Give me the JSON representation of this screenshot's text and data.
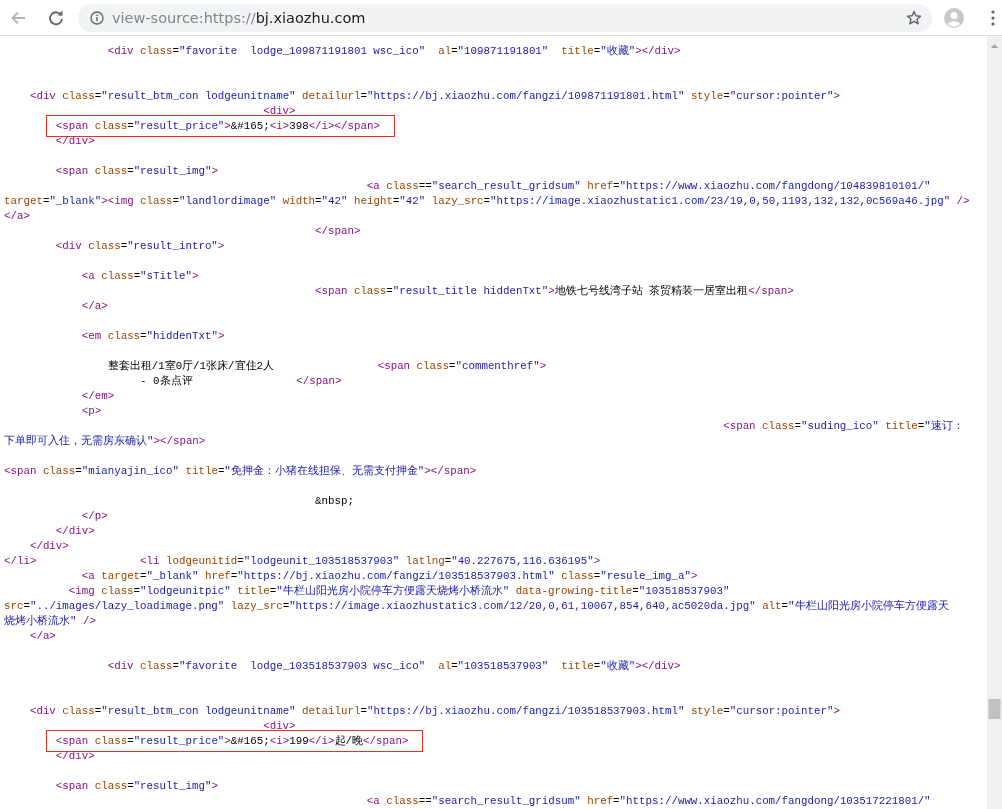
{
  "address_bar": {
    "scheme": "view-source:https://",
    "host": "bj.xiaozhu.com"
  },
  "source_lines": [
    {
      "kind": "code",
      "highlighted": false,
      "text": "                <div class=\"favorite  lodge_109871191801 wsc_ico\"  al=\"109871191801\"  title=\"收藏\"></div>"
    },
    {
      "kind": "blank"
    },
    {
      "kind": "blank"
    },
    {
      "kind": "code",
      "highlighted": false,
      "text": "    <div class=\"result_btm_con lodgeunitname\" detailurl=\"https://bj.xiaozhu.com/fangzi/109871191801.html\" style=\"cursor:pointer\">"
    },
    {
      "kind": "code",
      "highlighted": false,
      "text": "                                        <div>"
    },
    {
      "kind": "code",
      "highlighted": true,
      "text": "        <span class=\"result_price\">&#165;<i>398</i></span>"
    },
    {
      "kind": "code",
      "highlighted": false,
      "text": "        </div>"
    },
    {
      "kind": "blank"
    },
    {
      "kind": "code",
      "highlighted": false,
      "text": "        <span class=\"result_img\">"
    },
    {
      "kind": "code",
      "highlighted": false,
      "text": "                                                        <a class==\"search_result_gridsum\" href=\"https://www.xiaozhu.com/fangdong/104839810101/\""
    },
    {
      "kind": "code",
      "highlighted": false,
      "text": "target=\"_blank\"><img class=\"landlordimage\" width=\"42\" height=\"42\" lazy_src=\"https://image.xiaozhustatic1.com/23/19,0,50,1193,132,132,0c569a46.jpg\" />"
    },
    {
      "kind": "code",
      "highlighted": false,
      "text": "</a>"
    },
    {
      "kind": "code",
      "highlighted": false,
      "text": "                                                </span>"
    },
    {
      "kind": "code",
      "highlighted": false,
      "text": "        <div class=\"result_intro\">"
    },
    {
      "kind": "blank"
    },
    {
      "kind": "code",
      "highlighted": false,
      "text": "            <a class=\"sTitle\">"
    },
    {
      "kind": "code",
      "highlighted": false,
      "text": "                                                <span class=\"result_title hiddenTxt\">地铁七号线湾子站 茶贸精装一居室出租</span>"
    },
    {
      "kind": "code",
      "highlighted": false,
      "text": "            </a>"
    },
    {
      "kind": "blank"
    },
    {
      "kind": "code",
      "highlighted": false,
      "text": "            <em class=\"hiddenTxt\">"
    },
    {
      "kind": "blank"
    },
    {
      "kind": "code",
      "highlighted": false,
      "parts": [
        "                整套出租/1室0厅/1张床/宜住2人",
        "                <span class=\"commenthref\">"
      ]
    },
    {
      "kind": "code",
      "highlighted": false,
      "parts": [
        "                     - 0条点评",
        "                </span>"
      ]
    },
    {
      "kind": "code",
      "highlighted": false,
      "text": "            </em>"
    },
    {
      "kind": "code",
      "highlighted": false,
      "text": "            <p>"
    },
    {
      "kind": "code",
      "highlighted": false,
      "text": "                                                                                                               <span class=\"suding_ico\" title=\"速订："
    },
    {
      "kind": "code",
      "highlighted": false,
      "text": "下单即可入住，无需房东确认\"></span>"
    },
    {
      "kind": "blank"
    },
    {
      "kind": "code",
      "highlighted": false,
      "text": "<span class=\"mianyajin_ico\" title=\"免押金：小猪在线担保、无需支付押金\"></span>"
    },
    {
      "kind": "blank"
    },
    {
      "kind": "code",
      "highlighted": false,
      "text": "                                                &nbsp;"
    },
    {
      "kind": "code",
      "highlighted": false,
      "text": "            </p>"
    },
    {
      "kind": "code",
      "highlighted": false,
      "text": "        </div>"
    },
    {
      "kind": "code",
      "highlighted": false,
      "text": "    </div>"
    },
    {
      "kind": "code",
      "highlighted": false,
      "parts": [
        "</li>",
        "                <li lodgeunitid=\"lodgeunit_103518537903\" latlng=\"40.227675,116.636195\">"
      ]
    },
    {
      "kind": "code",
      "highlighted": false,
      "text": "            <a target=\"_blank\" href=\"https://bj.xiaozhu.com/fangzi/103518537903.html\" class=\"resule_img_a\">"
    },
    {
      "kind": "code",
      "highlighted": false,
      "text": "          <img class=\"lodgeunitpic\" title=\"牛栏山阳光房小院停车方便露天烧烤小桥流水\" data-growing-title=\"103518537903\""
    },
    {
      "kind": "code",
      "highlighted": false,
      "text": "src=\"../images/lazy_loadimage.png\" lazy_src=\"https://image.xiaozhustatic3.com/12/20,0,61,10067,854,640,ac5020da.jpg\" alt=\"牛栏山阳光房小院停车方便露天"
    },
    {
      "kind": "code",
      "highlighted": false,
      "text": "烧烤小桥流水\" />"
    },
    {
      "kind": "code",
      "highlighted": false,
      "text": "    </a>"
    },
    {
      "kind": "blank"
    },
    {
      "kind": "code",
      "highlighted": false,
      "text": "                <div class=\"favorite  lodge_103518537903 wsc_ico\"  al=\"103518537903\"  title=\"收藏\"></div>"
    },
    {
      "kind": "blank"
    },
    {
      "kind": "blank"
    },
    {
      "kind": "code",
      "highlighted": false,
      "text": "    <div class=\"result_btm_con lodgeunitname\" detailurl=\"https://bj.xiaozhu.com/fangzi/103518537903.html\" style=\"cursor:pointer\">"
    },
    {
      "kind": "code",
      "highlighted": false,
      "text": "                                        <div>"
    },
    {
      "kind": "code",
      "highlighted": true,
      "text": "        <span class=\"result_price\">&#165;<i>199</i>起/晚</span>"
    },
    {
      "kind": "code",
      "highlighted": false,
      "text": "        </div>"
    },
    {
      "kind": "blank"
    },
    {
      "kind": "code",
      "highlighted": false,
      "text": "        <span class=\"result_img\">"
    },
    {
      "kind": "code",
      "highlighted": false,
      "text": "                                                        <a class==\"search_result_gridsum\" href=\"https://www.xiaozhu.com/fangdong/103517221801/\""
    }
  ]
}
